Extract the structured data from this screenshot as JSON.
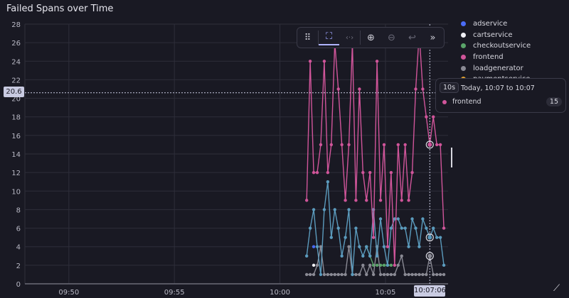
{
  "title": "Failed Spans over Time",
  "toolbar": {
    "drag": "⠿",
    "select": "⛶",
    "pan": "‹·›",
    "zoom_in": "⊕",
    "zoom_out": "⊖",
    "undo": "↩",
    "more": "»"
  },
  "legend": [
    {
      "name": "adservice",
      "color": "#4a6cf7"
    },
    {
      "name": "cartservice",
      "color": "#f0f0f5"
    },
    {
      "name": "checkoutservice",
      "color": "#5aa469"
    },
    {
      "name": "frontend",
      "color": "#d0559a"
    },
    {
      "name": "loadgenerator",
      "color": "#8a8a94"
    },
    {
      "name": "paymentservice",
      "color": "#e0a030"
    }
  ],
  "tooltip": {
    "interval": "10s",
    "range": "Today, 10:07 to 10:07",
    "series": "frontend",
    "value": "15",
    "color": "#d0559a"
  },
  "crosshair": {
    "y_label": "20.6",
    "x_label": "10:07:06"
  },
  "chart_data": {
    "type": "line",
    "title": "Failed Spans over Time",
    "ylim": [
      0,
      28
    ],
    "yticks": [
      0,
      2,
      4,
      6,
      8,
      10,
      12,
      14,
      16,
      18,
      20,
      22,
      24,
      26,
      28
    ],
    "xlim": [
      "09:47:55",
      "10:07:58"
    ],
    "xticks": [
      "09:50",
      "09:55",
      "10:00",
      "10:05"
    ],
    "grid": true,
    "legend_position": "right",
    "x": [
      "10:01:16",
      "10:01:26",
      "10:01:36",
      "10:01:46",
      "10:01:56",
      "10:02:06",
      "10:02:16",
      "10:02:26",
      "10:02:36",
      "10:02:46",
      "10:02:56",
      "10:03:06",
      "10:03:16",
      "10:03:26",
      "10:03:36",
      "10:03:46",
      "10:03:56",
      "10:04:06",
      "10:04:16",
      "10:04:26",
      "10:04:36",
      "10:04:46",
      "10:04:56",
      "10:05:06",
      "10:05:16",
      "10:05:26",
      "10:05:36",
      "10:05:46",
      "10:05:56",
      "10:06:06",
      "10:06:16",
      "10:06:26",
      "10:06:36",
      "10:06:46",
      "10:06:56",
      "10:07:06",
      "10:07:16",
      "10:07:26",
      "10:07:36",
      "10:07:46"
    ],
    "series": [
      {
        "name": "frontend",
        "color": "#d0559a",
        "values": [
          9,
          24,
          12,
          12,
          15,
          24,
          12,
          15,
          26,
          21,
          15,
          9,
          15,
          26,
          9,
          21,
          12,
          9,
          12,
          5,
          24,
          9,
          15,
          4,
          12,
          2,
          15,
          9,
          15,
          9,
          12,
          21,
          27,
          21,
          18,
          15,
          18,
          15,
          15,
          6
        ]
      },
      {
        "color": "#5b9bbd",
        "values": [
          3,
          6,
          8,
          4,
          1,
          8,
          11,
          5,
          8,
          6,
          3,
          5,
          8,
          1,
          6,
          4,
          3,
          4,
          3,
          8,
          3,
          7,
          4,
          2,
          6,
          7,
          7,
          6,
          6,
          4,
          7,
          6,
          4,
          7,
          6,
          5,
          6,
          5,
          5,
          2
        ]
      },
      {
        "name": "loadgenerator",
        "color": "#8a8a94",
        "values": [
          1,
          1,
          1,
          2,
          4,
          1,
          1,
          1,
          1,
          1,
          1,
          1,
          4,
          1,
          1,
          1,
          2,
          1,
          2,
          1,
          4,
          1,
          1,
          1,
          1,
          1,
          2,
          3,
          1,
          1,
          1,
          1,
          1,
          1,
          1,
          3,
          1,
          1,
          1,
          1
        ]
      },
      {
        "name": "checkoutservice",
        "color": "#5aa469",
        "values": [
          null,
          null,
          null,
          null,
          null,
          null,
          null,
          null,
          null,
          null,
          null,
          null,
          null,
          null,
          null,
          null,
          null,
          4,
          3,
          2,
          2,
          2,
          2,
          2,
          2,
          null,
          null,
          null,
          null,
          null,
          null,
          null,
          null,
          null,
          null,
          null,
          null,
          null,
          null,
          null
        ]
      },
      {
        "name": "adservice",
        "color": "#4a6cf7",
        "values": [
          null,
          null,
          4,
          null,
          null,
          null,
          null,
          null,
          null,
          null,
          null,
          null,
          null,
          null,
          null,
          null,
          null,
          null,
          null,
          null,
          null,
          null,
          null,
          null,
          null,
          null,
          null,
          null,
          null,
          null,
          null,
          null,
          null,
          null,
          null,
          null,
          null,
          null,
          null,
          null
        ]
      },
      {
        "name": "cartservice",
        "color": "#f0f0f5",
        "values": [
          null,
          null,
          2,
          null,
          null,
          null,
          null,
          null,
          null,
          null,
          null,
          null,
          null,
          null,
          null,
          null,
          null,
          null,
          null,
          null,
          null,
          null,
          null,
          null,
          null,
          null,
          null,
          null,
          null,
          null,
          null,
          null,
          null,
          null,
          null,
          null,
          null,
          null,
          null,
          null
        ]
      }
    ]
  }
}
